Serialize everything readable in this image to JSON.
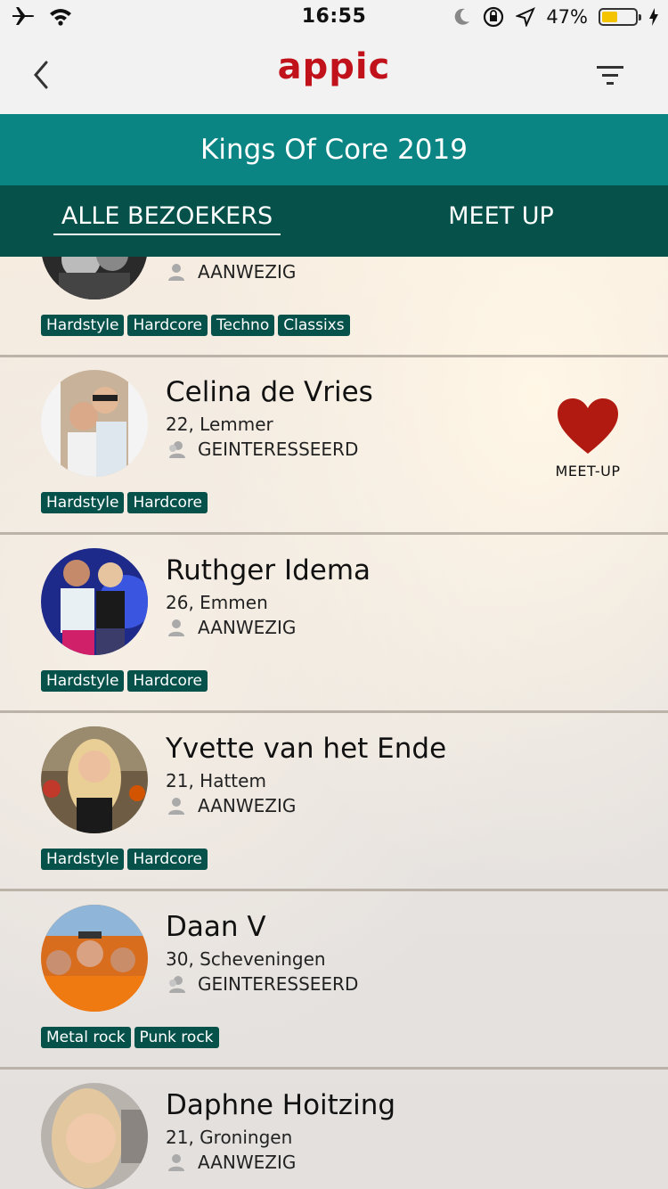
{
  "status_bar": {
    "time": "16:55",
    "battery": "47%",
    "battery_level": 0.47,
    "icons": [
      "airplane-icon",
      "wifi-icon",
      "moon-icon",
      "orientation-lock-icon",
      "location-arrow-icon",
      "battery-icon",
      "charging-bolt-icon"
    ]
  },
  "navbar": {
    "logo": "appic",
    "back_icon": "chevron-left-icon",
    "filter_icon": "filter-icon",
    "brand_color": "#c1121b"
  },
  "event": {
    "title": "Kings Of Core 2019",
    "header_color": "#0a8584"
  },
  "tabs": [
    {
      "label": "ALLE BEZOEKERS",
      "active": true
    },
    {
      "label": "MEET UP",
      "active": false
    }
  ],
  "colors": {
    "tab_bar": "#06514a",
    "tag_bg": "#06514a",
    "heart": "#b01a10"
  },
  "meetup_label": "MEET-UP",
  "attendees": [
    {
      "name": "",
      "sub": "",
      "status": "AANWEZIG",
      "tags": [
        "Hardstyle",
        "Hardcore",
        "Techno",
        "Classixs"
      ]
    },
    {
      "name": "Celina de Vries",
      "sub": "22, Lemmer",
      "status": "GEINTERESSEERD",
      "tags": [
        "Hardstyle",
        "Hardcore"
      ],
      "meetup": true
    },
    {
      "name": "Ruthger Idema",
      "sub": "26, Emmen",
      "status": "AANWEZIG",
      "tags": [
        "Hardstyle",
        "Hardcore"
      ]
    },
    {
      "name": "Yvette van het Ende",
      "sub": "21, Hattem",
      "status": "AANWEZIG",
      "tags": [
        "Hardstyle",
        "Hardcore"
      ]
    },
    {
      "name": "Daan V",
      "sub": "30, Scheveningen",
      "status": "GEINTERESSEERD",
      "tags": [
        "Metal rock",
        "Punk rock"
      ]
    },
    {
      "name": "Daphne Hoitzing",
      "sub": "21, Groningen",
      "status": "AANWEZIG",
      "tags": []
    }
  ]
}
